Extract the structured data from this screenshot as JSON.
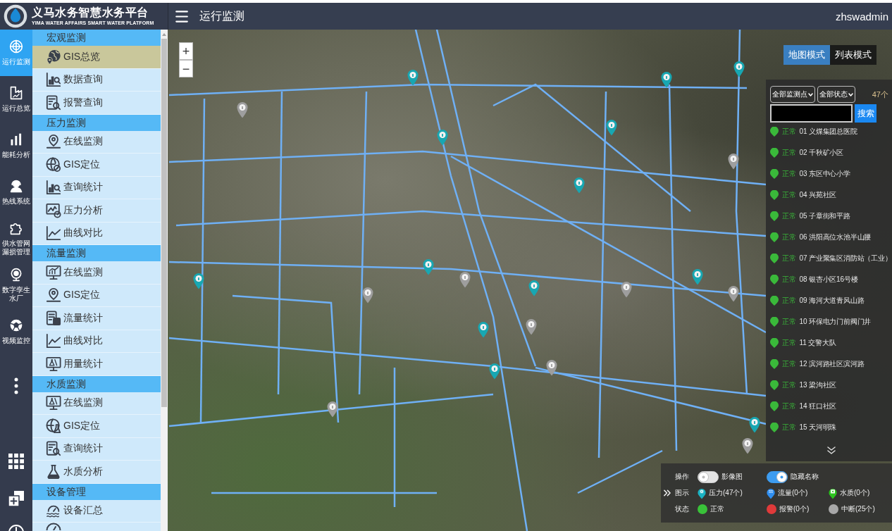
{
  "header": {
    "logo_title": "义马水务智慧水务平台",
    "logo_subtitle": "YIMA WATER AFFAIRS SMART WATER PLATFORM",
    "page_title": "运行监测",
    "user": "zhswadmin"
  },
  "nav": [
    {
      "label": "运行监测",
      "selected": true
    },
    {
      "label": "运行总览",
      "selected": false
    },
    {
      "label": "能耗分析",
      "selected": false
    },
    {
      "label": "热线系统",
      "selected": false
    },
    {
      "label": "供水管网漏损管理",
      "selected": false
    },
    {
      "label": "数字孪生水厂",
      "selected": false
    },
    {
      "label": "视频监控",
      "selected": false
    }
  ],
  "sidebar": {
    "sections": [
      {
        "title": "宏观监测",
        "items": [
          {
            "label": "GIS总览",
            "selected": true
          },
          {
            "label": "数据查询",
            "selected": false
          },
          {
            "label": "报警查询",
            "selected": false
          }
        ]
      },
      {
        "title": "压力监测",
        "items": [
          {
            "label": "在线监测",
            "selected": false
          },
          {
            "label": "GIS定位",
            "selected": false
          },
          {
            "label": "查询统计",
            "selected": false
          },
          {
            "label": "压力分析",
            "selected": false
          },
          {
            "label": "曲线对比",
            "selected": false
          }
        ]
      },
      {
        "title": "流量监测",
        "items": [
          {
            "label": "在线监测",
            "selected": false
          },
          {
            "label": "GIS定位",
            "selected": false
          },
          {
            "label": "流量统计",
            "selected": false
          },
          {
            "label": "曲线对比",
            "selected": false
          },
          {
            "label": "用量统计",
            "selected": false
          }
        ]
      },
      {
        "title": "水质监测",
        "items": [
          {
            "label": "在线监测",
            "selected": false
          },
          {
            "label": "GIS定位",
            "selected": false
          },
          {
            "label": "查询统计",
            "selected": false
          },
          {
            "label": "水质分析",
            "selected": false
          }
        ]
      },
      {
        "title": "设备管理",
        "items": [
          {
            "label": "设备汇总",
            "selected": false
          }
        ]
      }
    ]
  },
  "map": {
    "zoom_in": "+",
    "zoom_out": "−",
    "modes": [
      {
        "label": "地图模式",
        "selected": true
      },
      {
        "label": "列表模式",
        "selected": false
      }
    ],
    "markers": [
      {
        "color": "#18a7b2"
      },
      {
        "color": "#18a7b2"
      },
      {
        "color": "#18a7b2"
      },
      {
        "color": "#9e9e9e"
      },
      {
        "color": "#18a7b2"
      },
      {
        "color": "#18a7b2"
      },
      {
        "color": "#9e9e9e"
      },
      {
        "color": "#18a7b2"
      },
      {
        "color": "#18a7b2"
      },
      {
        "color": "#18a7b2"
      },
      {
        "color": "#9e9e9e"
      },
      {
        "color": "#18a7b2"
      },
      {
        "color": "#18a7b2"
      },
      {
        "color": "#9e9e9e"
      },
      {
        "color": "#9e9e9e"
      },
      {
        "color": "#9e9e9e"
      },
      {
        "color": "#9e9e9e"
      },
      {
        "color": "#18a7b2"
      },
      {
        "color": "#9e9e9e"
      },
      {
        "color": "#18a7b2"
      },
      {
        "color": "#9e9e9e"
      },
      {
        "color": "#18a7b2"
      },
      {
        "color": "#9e9e9e"
      }
    ]
  },
  "station_panel": {
    "filters": [
      "全部监测点",
      "全部状态"
    ],
    "count": "47个",
    "search_button": "搜索",
    "stations": [
      {
        "status": "正常",
        "color": "#3ab93a",
        "name": "01 义煤集团总医院"
      },
      {
        "status": "正常",
        "color": "#3ab93a",
        "name": "02 千秋矿小区"
      },
      {
        "status": "正常",
        "color": "#3ab93a",
        "name": "03 东区中心小学"
      },
      {
        "status": "正常",
        "color": "#3ab93a",
        "name": "04 兴苑社区"
      },
      {
        "status": "正常",
        "color": "#3ab93a",
        "name": "05 子章街和平路"
      },
      {
        "status": "正常",
        "color": "#3ab93a",
        "name": "06 洪阳高位水池半山腰"
      },
      {
        "status": "正常",
        "color": "#3ab93a",
        "name": "07 产业聚集区消防站（工业）"
      },
      {
        "status": "正常",
        "color": "#3ab93a",
        "name": "08 银杏小区16号楼"
      },
      {
        "status": "正常",
        "color": "#3ab93a",
        "name": "09 海河大道青风山路"
      },
      {
        "status": "正常",
        "color": "#3ab93a",
        "name": "10 环保电力门前阀门井"
      },
      {
        "status": "正常",
        "color": "#3ab93a",
        "name": "11 交警大队"
      },
      {
        "status": "正常",
        "color": "#3ab93a",
        "name": "12 滨河路社区滨河路"
      },
      {
        "status": "正常",
        "color": "#3ab93a",
        "name": "13 梁沟社区"
      },
      {
        "status": "正常",
        "color": "#3ab93a",
        "name": "14 狂口社区"
      },
      {
        "status": "正常",
        "color": "#3ab93a",
        "name": "15 天河明珠"
      }
    ]
  },
  "legend": {
    "rows": [
      {
        "label": "操作",
        "items": [
          {
            "kind": "toggle",
            "label": "影像图",
            "on": false
          },
          {
            "kind": "toggle",
            "label": "隐藏名称",
            "on": true
          }
        ]
      },
      {
        "label": "图示",
        "items": [
          {
            "kind": "pin",
            "label": "压力(47个)",
            "color": "#1ab2c2"
          },
          {
            "kind": "pin",
            "label": "流量(0个)",
            "color": "#2f8ef0"
          },
          {
            "kind": "pin",
            "label": "水质(0个)",
            "color": "#2cc31f"
          }
        ]
      },
      {
        "label": "状态",
        "items": [
          {
            "kind": "dot",
            "label": "正常",
            "color": "#39c239"
          },
          {
            "kind": "dot",
            "label": "报警(0个)",
            "color": "#e03a3a"
          },
          {
            "kind": "dot",
            "label": "中断(25个)",
            "color": "#a8a8a8"
          }
        ]
      }
    ]
  }
}
